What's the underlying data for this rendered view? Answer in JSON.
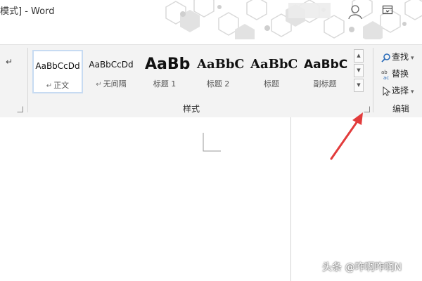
{
  "titlebar": {
    "title": "模式] - Word",
    "user_icon": "user-icon",
    "display_icon": "ribbon-display-options-icon"
  },
  "ribbon": {
    "styles": {
      "group_label": "样式",
      "items": [
        {
          "sample": "AaBbCcDd",
          "name": "正文",
          "para_mark": true,
          "selected": true
        },
        {
          "sample": "AaBbCcDd",
          "name": "无间隔",
          "para_mark": true,
          "selected": false
        },
        {
          "sample": "AaBb",
          "name": "标题 1",
          "para_mark": false,
          "selected": false
        },
        {
          "sample": "AaBbC",
          "name": "标题 2",
          "para_mark": false,
          "selected": false
        },
        {
          "sample": "AaBbC",
          "name": "标题",
          "para_mark": false,
          "selected": false
        },
        {
          "sample": "AaBbC",
          "name": "副标题",
          "para_mark": false,
          "selected": false
        }
      ]
    },
    "editing": {
      "group_label": "编辑",
      "find_label": "查找",
      "replace_label": "替换",
      "select_label": "选择"
    }
  },
  "watermark": "头条 @咋啊咋啊N",
  "colors": {
    "annotation_arrow": "#e23b3b",
    "selected_border": "#c7dbf2",
    "ribbon_bg": "#f3f3f3"
  }
}
